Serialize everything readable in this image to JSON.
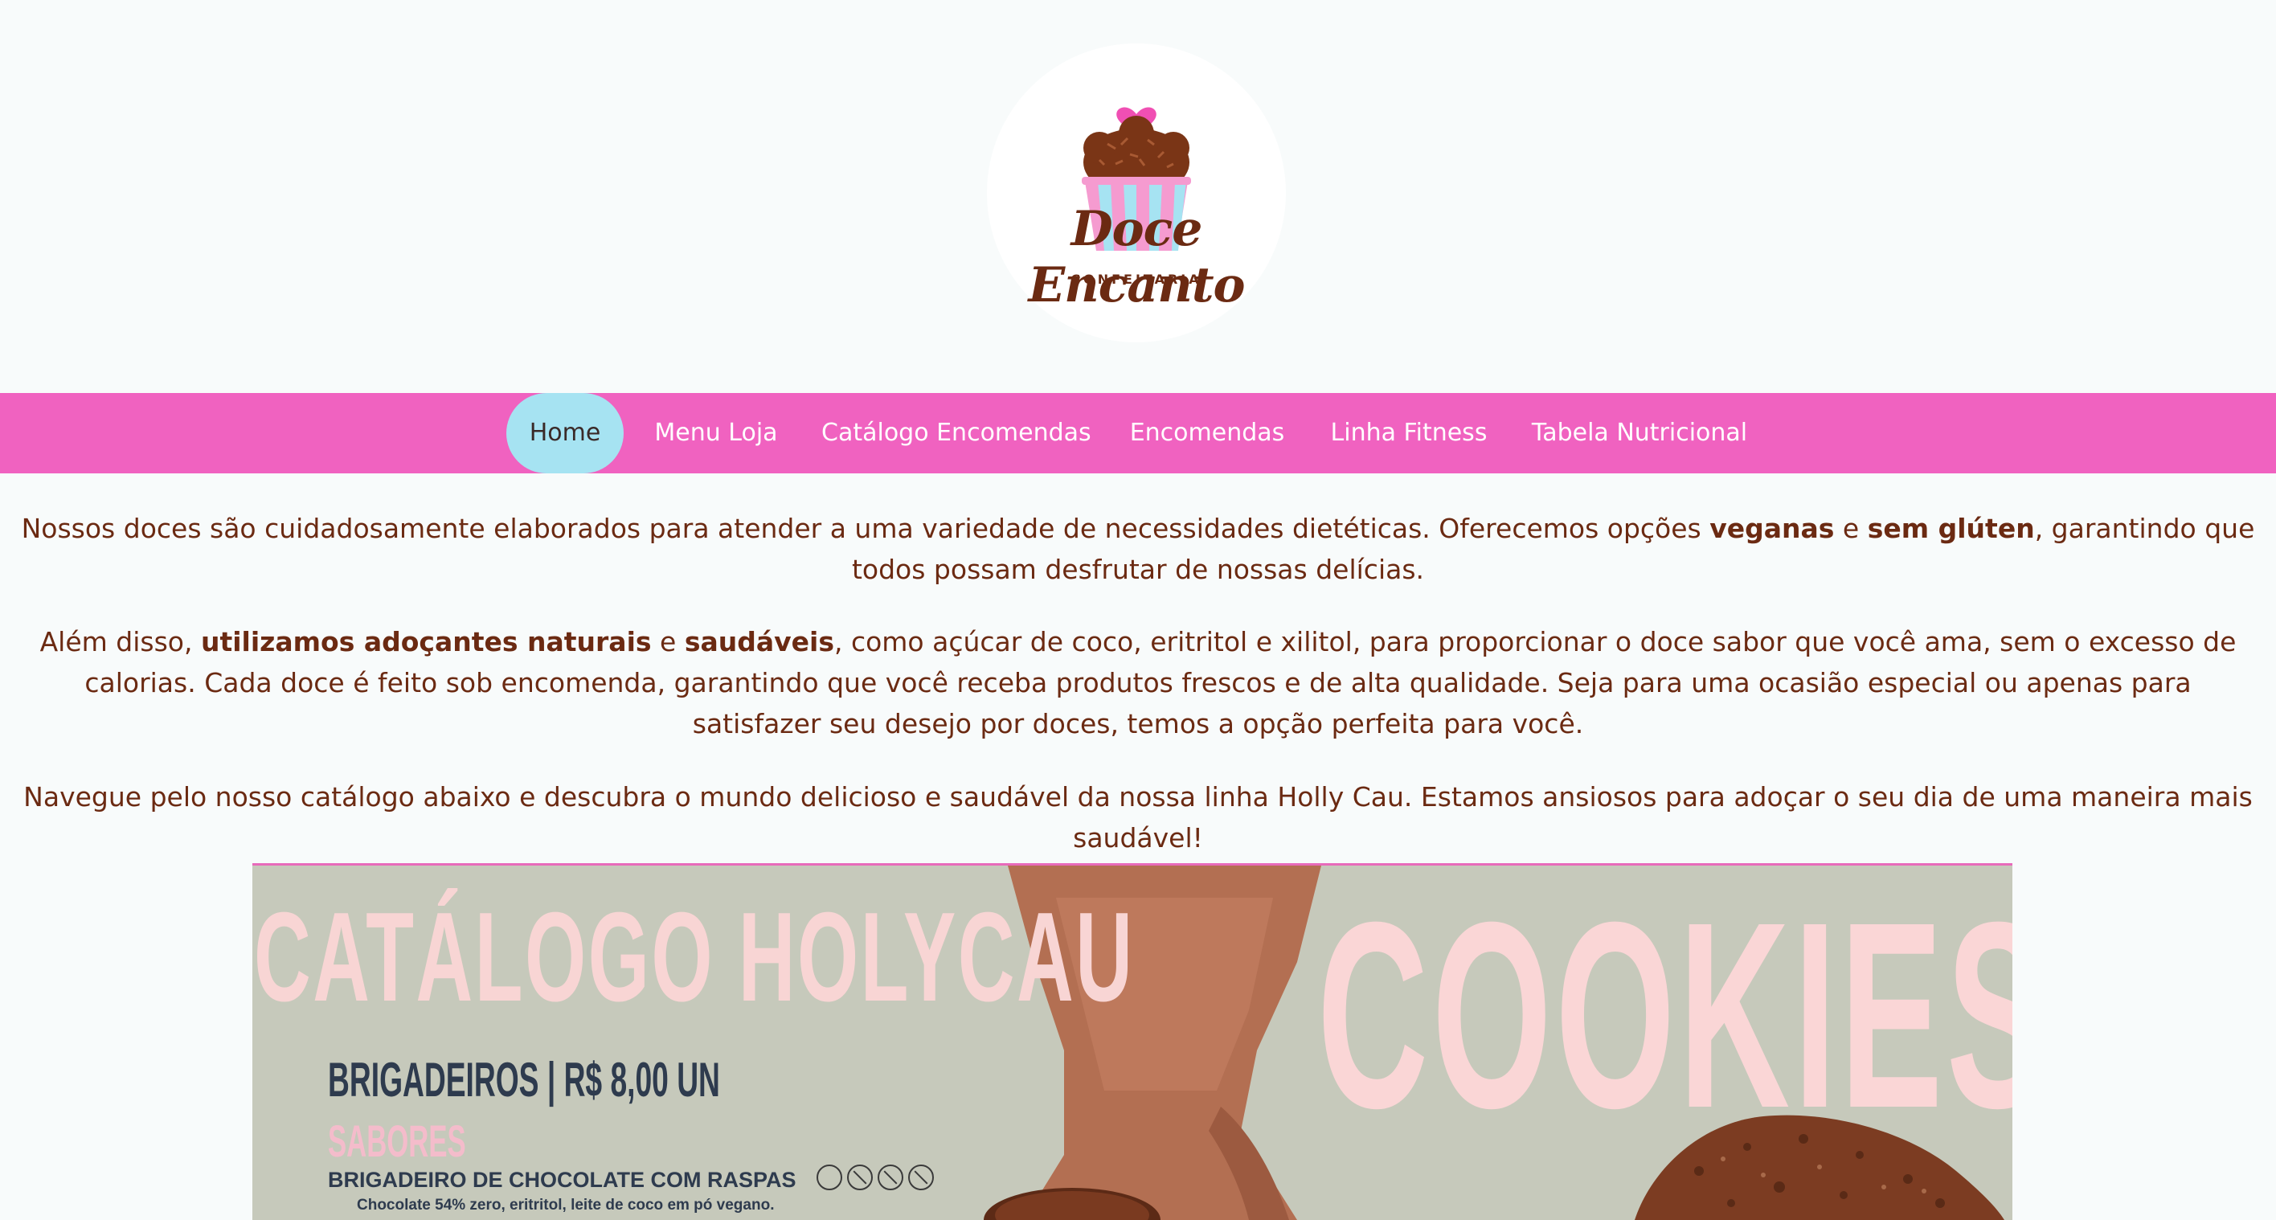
{
  "logo": {
    "brand_name": "Doce Encanto",
    "tagline": "CONFEITARIA"
  },
  "nav": {
    "items": [
      {
        "label": "Home",
        "active": true
      },
      {
        "label": "Menu Loja",
        "active": false
      },
      {
        "label": "Catálogo Encomendas",
        "active": false
      },
      {
        "label": "Encomendas",
        "active": false
      },
      {
        "label": "Linha Fitness",
        "active": false
      },
      {
        "label": "Tabela Nutricional",
        "active": false
      }
    ]
  },
  "intro": {
    "p1_part1": "Nossos doces são cuidadosamente elaborados para atender a uma variedade de necessidades dietéticas. Oferecemos opções ",
    "p1_bold1": "veganas",
    "p1_part2": " e ",
    "p1_bold2": "sem glúten",
    "p1_part3": ", garantindo que todos possam desfrutar de nossas delícias.",
    "p2_part1": "Além disso, ",
    "p2_bold1": "utilizamos adoçantes naturais",
    "p2_part2": " e ",
    "p2_bold2": "saudáveis",
    "p2_part3": ", como açúcar de coco, eritritol e xilitol, para proporcionar o doce sabor que você ama, sem o excesso de calorias. Cada doce é feito sob encomenda, garantindo que você receba produtos frescos e de alta qualidade. Seja para uma ocasião especial ou apenas para satisfazer seu desejo por doces, temos a opção perfeita para você.",
    "p3": "Navegue pelo nosso catálogo abaixo e descubra o mundo delicioso e saudável da nossa linha Holly Cau. Estamos ansiosos para adoçar o seu dia de uma maneira mais saudável!"
  },
  "catalog": {
    "title": "CATÁLOGO HOLYCAU",
    "big_word": "COOKIES",
    "price_line": "BRIGADEIROS | R$ 8,00 UN",
    "flavors_heading": "SABORES",
    "flavor_name": "BRIGADEIRO DE CHOCOLATE COM RASPAS",
    "flavor_desc": "Chocolate 54% zero, eritritol, leite de coco em pó vegano."
  },
  "colors": {
    "nav_bg": "#f062c0",
    "nav_active_bg": "#a6e3f2",
    "text_brown": "#6b2a12",
    "page_bg": "#f8fbfb",
    "catalog_bg": "#c6c9bb"
  }
}
